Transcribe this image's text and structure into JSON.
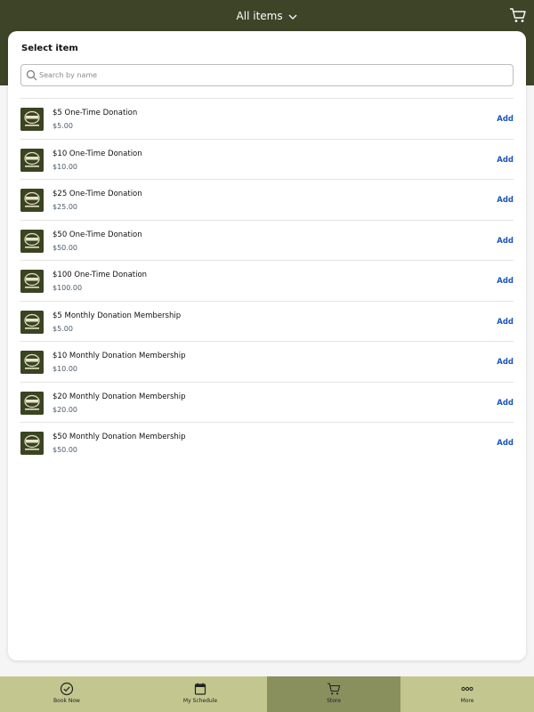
{
  "header": {
    "title": "All items",
    "cart_icon": "cart-icon",
    "background": "#3d4428"
  },
  "card": {
    "title": "Select item",
    "search_placeholder": "Search by name"
  },
  "items": [
    {
      "name": "$5 One-Time Donation",
      "price": "$5.00",
      "action": "Add"
    },
    {
      "name": "$10 One-Time Donation",
      "price": "$10.00",
      "action": "Add"
    },
    {
      "name": "$25 One-Time Donation",
      "price": "$25.00",
      "action": "Add"
    },
    {
      "name": "$50 One-Time Donation",
      "price": "$50.00",
      "action": "Add"
    },
    {
      "name": "$100 One-Time Donation",
      "price": "$100.00",
      "action": "Add"
    },
    {
      "name": "$5 Monthly Donation Membership",
      "price": "$5.00",
      "action": "Add"
    },
    {
      "name": "$10 Monthly Donation Membership",
      "price": "$10.00",
      "action": "Add"
    },
    {
      "name": "$20 Monthly Donation Membership",
      "price": "$20.00",
      "action": "Add"
    },
    {
      "name": "$50 Monthly Donation Membership",
      "price": "$50.00",
      "action": "Add"
    }
  ],
  "nav": {
    "items": [
      {
        "label": "Book Now",
        "icon": "check-circle-icon",
        "active": false
      },
      {
        "label": "My Schedule",
        "icon": "calendar-icon",
        "active": false
      },
      {
        "label": "Store",
        "icon": "cart-icon",
        "active": true
      },
      {
        "label": "More",
        "icon": "more-icon",
        "active": false
      }
    ],
    "background": "#c3c78f",
    "active_background": "#8a8f5e"
  },
  "colors": {
    "link": "#1a55b8",
    "price": "#4a5a6a"
  }
}
